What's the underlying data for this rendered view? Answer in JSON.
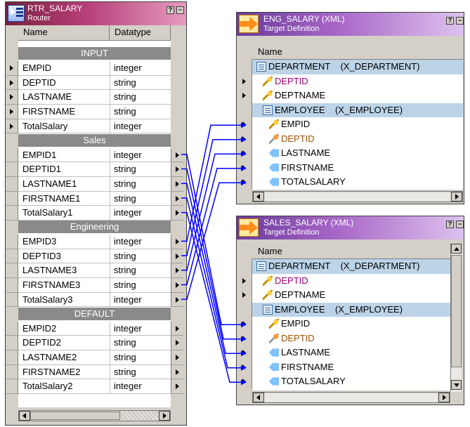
{
  "router": {
    "title": "RTR_SALARY",
    "subtitle": "Router",
    "headers": {
      "name": "Name",
      "datatype": "Datatype"
    },
    "groups": [
      {
        "label": "INPUT",
        "rows": [
          {
            "name": "EMPID",
            "type": "integer"
          },
          {
            "name": "DEPTID",
            "type": "string"
          },
          {
            "name": "LASTNAME",
            "type": "string"
          },
          {
            "name": "FIRSTNAME",
            "type": "string"
          },
          {
            "name": "TotalSalary",
            "type": "integer"
          }
        ]
      },
      {
        "label": "Sales",
        "rows": [
          {
            "name": "EMPID1",
            "type": "integer"
          },
          {
            "name": "DEPTID1",
            "type": "string"
          },
          {
            "name": "LASTNAME1",
            "type": "string"
          },
          {
            "name": "FIRSTNAME1",
            "type": "string"
          },
          {
            "name": "TotalSalary1",
            "type": "integer"
          }
        ]
      },
      {
        "label": "Engineering",
        "rows": [
          {
            "name": "EMPID3",
            "type": "integer"
          },
          {
            "name": "DEPTID3",
            "type": "string"
          },
          {
            "name": "LASTNAME3",
            "type": "string"
          },
          {
            "name": "FIRSTNAME3",
            "type": "string"
          },
          {
            "name": "TotalSalary3",
            "type": "integer"
          }
        ]
      },
      {
        "label": "DEFAULT",
        "rows": [
          {
            "name": "EMPID2",
            "type": "integer"
          },
          {
            "name": "DEPTID2",
            "type": "string"
          },
          {
            "name": "LASTNAME2",
            "type": "string"
          },
          {
            "name": "FIRSTNAME2",
            "type": "string"
          },
          {
            "name": "TotalSalary2",
            "type": "integer"
          }
        ]
      }
    ]
  },
  "eng_target": {
    "title": "ENG_SALARY (XML)",
    "subtitle": "Target Definition",
    "header": "Name",
    "rows": [
      {
        "text": "DEPARTMENT    (X_DEPARTMENT)",
        "icon": "table-icon",
        "indent": 0,
        "hl": true,
        "arrow": false,
        "color": "#000000"
      },
      {
        "text": "DEPTID",
        "icon": "key-icon",
        "indent": 1,
        "hl": false,
        "arrow": true,
        "color": "#9c007a"
      },
      {
        "text": "DEPTNAME",
        "icon": "key-icon",
        "indent": 1,
        "hl": false,
        "arrow": true,
        "color": "#000000"
      },
      {
        "text": "EMPLOYEE    (X_EMPLOYEE)",
        "icon": "table-icon",
        "indent": 1,
        "hl": true,
        "arrow": false,
        "color": "#000000"
      },
      {
        "text": "EMPID",
        "icon": "key-icon",
        "indent": 2,
        "hl": false,
        "arrow": true,
        "color": "#000000"
      },
      {
        "text": "DEPTID",
        "icon": "foreign-key-icon",
        "indent": 2,
        "hl": false,
        "arrow": true,
        "color": "#a05000"
      },
      {
        "text": "LASTNAME",
        "icon": "tag-icon",
        "indent": 2,
        "hl": false,
        "arrow": true,
        "color": "#000000"
      },
      {
        "text": "FIRSTNAME",
        "icon": "tag-icon",
        "indent": 2,
        "hl": false,
        "arrow": true,
        "color": "#000000"
      },
      {
        "text": "TOTALSALARY",
        "icon": "tag-icon",
        "indent": 2,
        "hl": false,
        "arrow": true,
        "color": "#000000"
      }
    ]
  },
  "sales_target": {
    "title": "SALES_SALARY (XML)",
    "subtitle": "Target Definition",
    "header": "Name",
    "rows": [
      {
        "text": "DEPARTMENT    (X_DEPARTMENT)",
        "icon": "table-icon",
        "indent": 0,
        "hl": true,
        "arrow": false,
        "color": "#000000"
      },
      {
        "text": "DEPTID",
        "icon": "key-icon",
        "indent": 1,
        "hl": false,
        "arrow": true,
        "color": "#9c007a"
      },
      {
        "text": "DEPTNAME",
        "icon": "key-icon",
        "indent": 1,
        "hl": false,
        "arrow": true,
        "color": "#000000"
      },
      {
        "text": "EMPLOYEE    (X_EMPLOYEE)",
        "icon": "table-icon",
        "indent": 1,
        "hl": true,
        "arrow": false,
        "color": "#000000"
      },
      {
        "text": "EMPID",
        "icon": "key-icon",
        "indent": 2,
        "hl": false,
        "arrow": true,
        "color": "#000000"
      },
      {
        "text": "DEPTID",
        "icon": "foreign-key-icon",
        "indent": 2,
        "hl": false,
        "arrow": true,
        "color": "#a05000"
      },
      {
        "text": "LASTNAME",
        "icon": "tag-icon",
        "indent": 2,
        "hl": false,
        "arrow": true,
        "color": "#000000"
      },
      {
        "text": "FIRSTNAME",
        "icon": "tag-icon",
        "indent": 2,
        "hl": false,
        "arrow": true,
        "color": "#000000"
      },
      {
        "text": "TOTALSALARY",
        "icon": "tag-icon",
        "indent": 2,
        "hl": false,
        "arrow": true,
        "color": "#000000"
      }
    ]
  },
  "colors": {
    "link": "#0000ff",
    "group_bar": "#8a8a8a",
    "row_highlight": "#bcd3e8"
  }
}
